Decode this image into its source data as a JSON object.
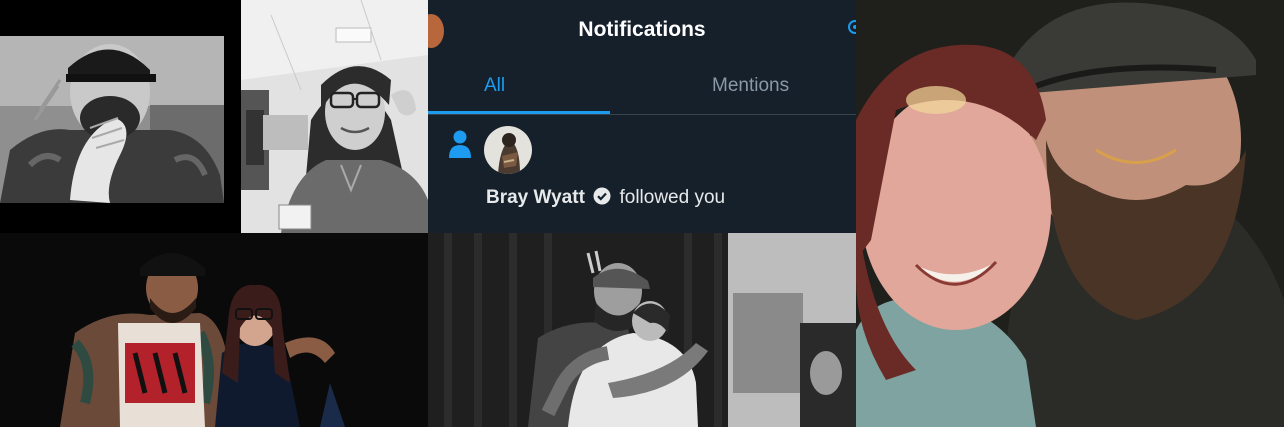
{
  "notifications": {
    "title": "Notifications",
    "tabs": [
      {
        "label": "All",
        "active": true
      },
      {
        "label": "Mentions",
        "active": false
      }
    ],
    "item": {
      "icon": "person-icon",
      "user_name": "Bray Wyatt",
      "verified": true,
      "action_text": "followed you"
    }
  },
  "colors": {
    "accent": "#1d9bf0",
    "panel_background": "#15202b",
    "muted_text": "#8b98a5",
    "divider": "#38444d"
  }
}
